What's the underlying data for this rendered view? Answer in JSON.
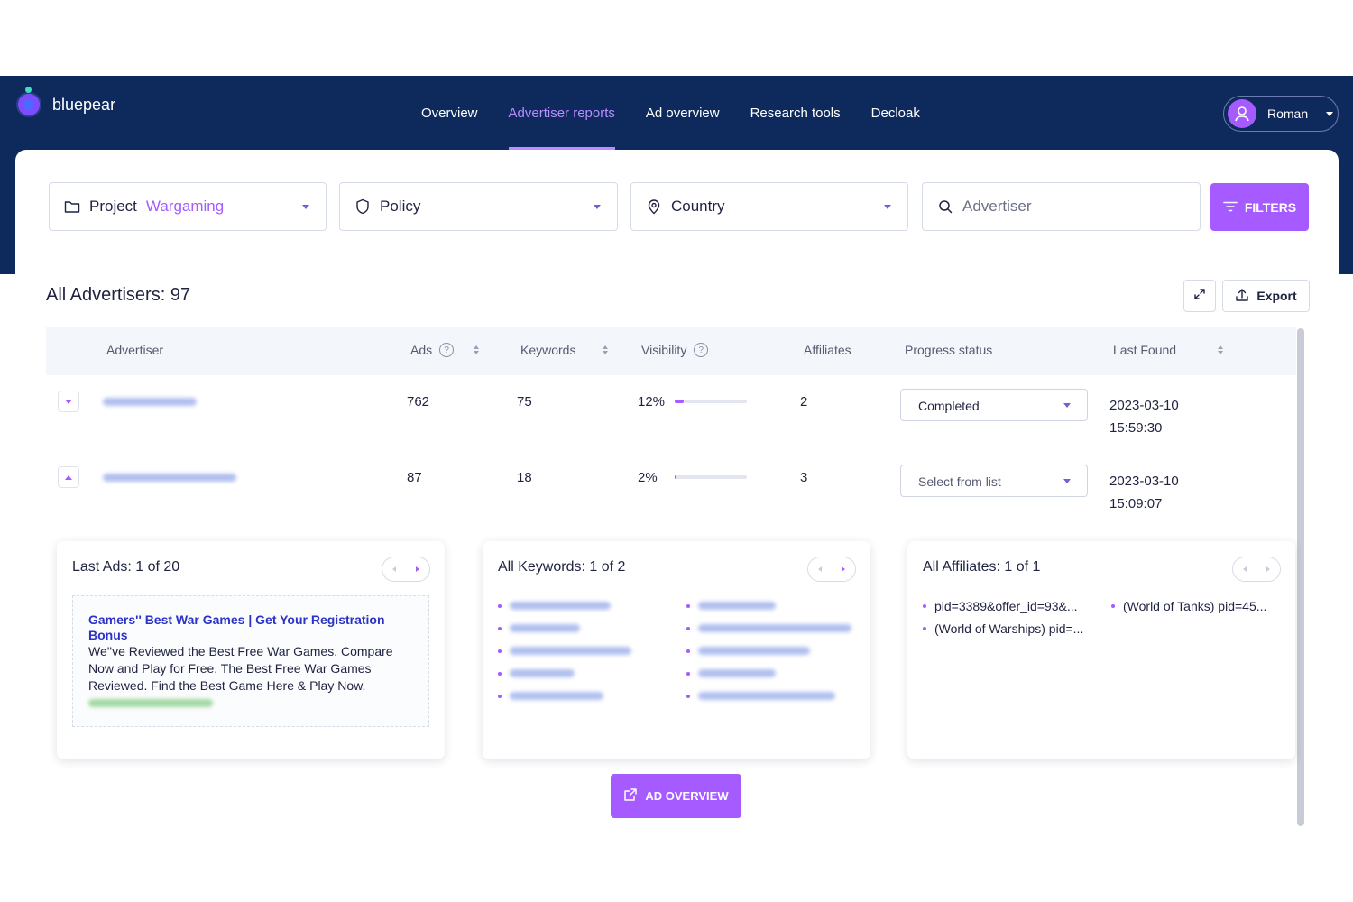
{
  "app": {
    "logo_text": "bluepear"
  },
  "nav": {
    "items": [
      "Overview",
      "Advertiser reports",
      "Ad overview",
      "Research tools",
      "Decloak"
    ],
    "active_index": 1
  },
  "user": {
    "name": "Roman"
  },
  "filters": {
    "project_label": "Project",
    "project_value": "Wargaming",
    "policy_label": "Policy",
    "country_label": "Country",
    "advertiser_placeholder": "Advertiser",
    "filters_button": "FILTERS"
  },
  "page": {
    "title": "All Advertisers: 97",
    "export_label": "Export"
  },
  "table": {
    "headers": {
      "advertiser": "Advertiser",
      "ads": "Ads",
      "keywords": "Keywords",
      "visibility": "Visibility",
      "affiliates": "Affiliates",
      "progress": "Progress status",
      "last_found": "Last Found"
    },
    "rows": [
      {
        "ads": "762",
        "keywords": "75",
        "visibility": "12%",
        "visibility_fraction": 0.12,
        "affiliates": "2",
        "status": "Completed",
        "date": "2023-03-10",
        "time": "15:59:30",
        "expanded": false
      },
      {
        "ads": "87",
        "keywords": "18",
        "visibility": "2%",
        "visibility_fraction": 0.02,
        "affiliates": "3",
        "status": "Select from list",
        "date": "2023-03-10",
        "time": "15:09:07",
        "expanded": true
      }
    ]
  },
  "panels": {
    "ads": {
      "title": "Last Ads: 1 of 20",
      "headline": "Gamers'' Best War Games | Get Your Registration Bonus",
      "description": "We''ve Reviewed the Best Free War Games. Compare Now and Play for Free. The Best Free War Games Reviewed. Find the Best Game Here & Play Now."
    },
    "keywords": {
      "title": "All Keywords: 1 of 2"
    },
    "affiliates": {
      "title": "All Affiliates: 1 of 1",
      "items": [
        "pid=3389&offer_id=93&...",
        "(World of Warships) pid=...",
        "(World of Tanks) pid=45..."
      ]
    }
  },
  "actions": {
    "ad_overview": "AD OVERVIEW"
  },
  "colors": {
    "navy": "#0e2a5c",
    "accent": "#a55bff",
    "link": "#2a32c8"
  }
}
